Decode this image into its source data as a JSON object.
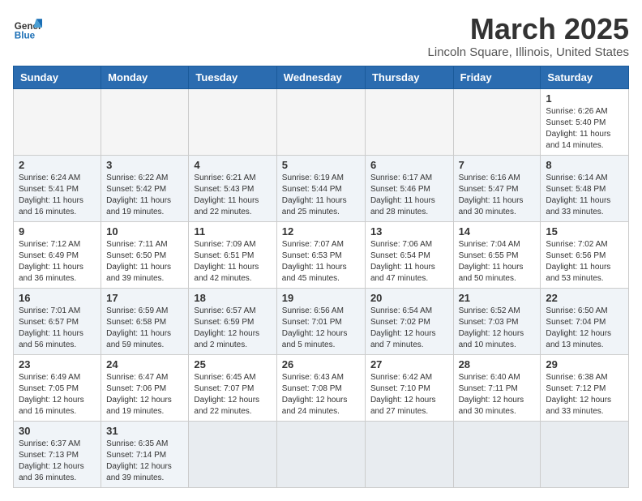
{
  "header": {
    "logo_text_black": "General",
    "logo_text_blue": "Blue",
    "month": "March 2025",
    "location": "Lincoln Square, Illinois, United States"
  },
  "weekdays": [
    "Sunday",
    "Monday",
    "Tuesday",
    "Wednesday",
    "Thursday",
    "Friday",
    "Saturday"
  ],
  "weeks": [
    [
      {
        "day": "",
        "info": ""
      },
      {
        "day": "",
        "info": ""
      },
      {
        "day": "",
        "info": ""
      },
      {
        "day": "",
        "info": ""
      },
      {
        "day": "",
        "info": ""
      },
      {
        "day": "",
        "info": ""
      },
      {
        "day": "1",
        "info": "Sunrise: 6:26 AM\nSunset: 5:40 PM\nDaylight: 11 hours and 14 minutes."
      }
    ],
    [
      {
        "day": "2",
        "info": "Sunrise: 6:24 AM\nSunset: 5:41 PM\nDaylight: 11 hours and 16 minutes."
      },
      {
        "day": "3",
        "info": "Sunrise: 6:22 AM\nSunset: 5:42 PM\nDaylight: 11 hours and 19 minutes."
      },
      {
        "day": "4",
        "info": "Sunrise: 6:21 AM\nSunset: 5:43 PM\nDaylight: 11 hours and 22 minutes."
      },
      {
        "day": "5",
        "info": "Sunrise: 6:19 AM\nSunset: 5:44 PM\nDaylight: 11 hours and 25 minutes."
      },
      {
        "day": "6",
        "info": "Sunrise: 6:17 AM\nSunset: 5:46 PM\nDaylight: 11 hours and 28 minutes."
      },
      {
        "day": "7",
        "info": "Sunrise: 6:16 AM\nSunset: 5:47 PM\nDaylight: 11 hours and 30 minutes."
      },
      {
        "day": "8",
        "info": "Sunrise: 6:14 AM\nSunset: 5:48 PM\nDaylight: 11 hours and 33 minutes."
      }
    ],
    [
      {
        "day": "9",
        "info": "Sunrise: 7:12 AM\nSunset: 6:49 PM\nDaylight: 11 hours and 36 minutes."
      },
      {
        "day": "10",
        "info": "Sunrise: 7:11 AM\nSunset: 6:50 PM\nDaylight: 11 hours and 39 minutes."
      },
      {
        "day": "11",
        "info": "Sunrise: 7:09 AM\nSunset: 6:51 PM\nDaylight: 11 hours and 42 minutes."
      },
      {
        "day": "12",
        "info": "Sunrise: 7:07 AM\nSunset: 6:53 PM\nDaylight: 11 hours and 45 minutes."
      },
      {
        "day": "13",
        "info": "Sunrise: 7:06 AM\nSunset: 6:54 PM\nDaylight: 11 hours and 47 minutes."
      },
      {
        "day": "14",
        "info": "Sunrise: 7:04 AM\nSunset: 6:55 PM\nDaylight: 11 hours and 50 minutes."
      },
      {
        "day": "15",
        "info": "Sunrise: 7:02 AM\nSunset: 6:56 PM\nDaylight: 11 hours and 53 minutes."
      }
    ],
    [
      {
        "day": "16",
        "info": "Sunrise: 7:01 AM\nSunset: 6:57 PM\nDaylight: 11 hours and 56 minutes."
      },
      {
        "day": "17",
        "info": "Sunrise: 6:59 AM\nSunset: 6:58 PM\nDaylight: 11 hours and 59 minutes."
      },
      {
        "day": "18",
        "info": "Sunrise: 6:57 AM\nSunset: 6:59 PM\nDaylight: 12 hours and 2 minutes."
      },
      {
        "day": "19",
        "info": "Sunrise: 6:56 AM\nSunset: 7:01 PM\nDaylight: 12 hours and 5 minutes."
      },
      {
        "day": "20",
        "info": "Sunrise: 6:54 AM\nSunset: 7:02 PM\nDaylight: 12 hours and 7 minutes."
      },
      {
        "day": "21",
        "info": "Sunrise: 6:52 AM\nSunset: 7:03 PM\nDaylight: 12 hours and 10 minutes."
      },
      {
        "day": "22",
        "info": "Sunrise: 6:50 AM\nSunset: 7:04 PM\nDaylight: 12 hours and 13 minutes."
      }
    ],
    [
      {
        "day": "23",
        "info": "Sunrise: 6:49 AM\nSunset: 7:05 PM\nDaylight: 12 hours and 16 minutes."
      },
      {
        "day": "24",
        "info": "Sunrise: 6:47 AM\nSunset: 7:06 PM\nDaylight: 12 hours and 19 minutes."
      },
      {
        "day": "25",
        "info": "Sunrise: 6:45 AM\nSunset: 7:07 PM\nDaylight: 12 hours and 22 minutes."
      },
      {
        "day": "26",
        "info": "Sunrise: 6:43 AM\nSunset: 7:08 PM\nDaylight: 12 hours and 24 minutes."
      },
      {
        "day": "27",
        "info": "Sunrise: 6:42 AM\nSunset: 7:10 PM\nDaylight: 12 hours and 27 minutes."
      },
      {
        "day": "28",
        "info": "Sunrise: 6:40 AM\nSunset: 7:11 PM\nDaylight: 12 hours and 30 minutes."
      },
      {
        "day": "29",
        "info": "Sunrise: 6:38 AM\nSunset: 7:12 PM\nDaylight: 12 hours and 33 minutes."
      }
    ],
    [
      {
        "day": "30",
        "info": "Sunrise: 6:37 AM\nSunset: 7:13 PM\nDaylight: 12 hours and 36 minutes."
      },
      {
        "day": "31",
        "info": "Sunrise: 6:35 AM\nSunset: 7:14 PM\nDaylight: 12 hours and 39 minutes."
      },
      {
        "day": "",
        "info": ""
      },
      {
        "day": "",
        "info": ""
      },
      {
        "day": "",
        "info": ""
      },
      {
        "day": "",
        "info": ""
      },
      {
        "day": "",
        "info": ""
      }
    ]
  ]
}
